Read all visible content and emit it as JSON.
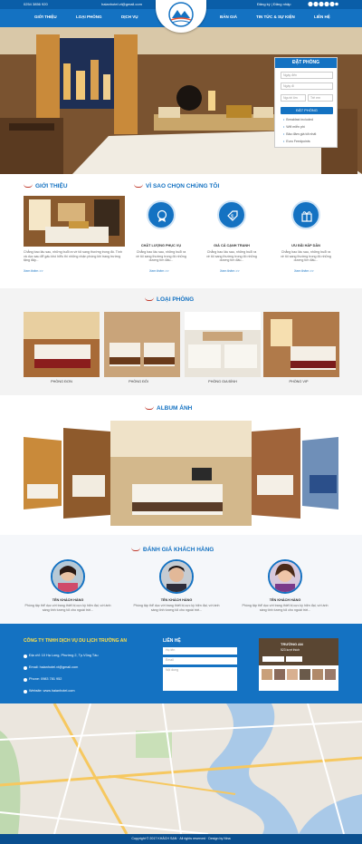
{
  "topbar": {
    "phone": "0254 3856 920",
    "email": "haianhotel.vt@gmail.com",
    "user": "Đăng ký | Đăng nhập",
    "socials": [
      "facebook-icon",
      "twitter-icon",
      "google-plus-icon",
      "youtube-icon",
      "pinterest-icon",
      "linkedin-icon"
    ]
  },
  "nav": {
    "left": [
      "GIỚI THIỆU",
      "LOẠI PHÒNG",
      "DỊCH VỤ"
    ],
    "right": [
      "BẢN GIÁ",
      "TIN TỨC & SỰ KIỆN",
      "LIÊN HỆ"
    ]
  },
  "booking": {
    "title": "ĐẶT PHÒNG",
    "fields": [
      "Ngày đến",
      "Ngày đi",
      "Người lớn",
      "Trẻ em"
    ],
    "button": "ĐẶT PHÒNG",
    "features": [
      "Breakfast included",
      "Wifi miễn phí",
      "Bảo đảm giá tốt nhất",
      "Euro Feedpoints"
    ]
  },
  "about": {
    "title": "GIỚI THIỆU",
    "text": "Chẳng bao lâu sau, những buổi ra về tôi sang thường trong đó. Tình và dục sau để gấu khó hiểu thì những nhận phòng khi trang trường tặng đấy...",
    "more": "Xem thêm >>"
  },
  "why": {
    "title": "VÌ SAO CHỌN CHÚNG TÔI",
    "items": [
      {
        "title": "CHẤT LƯỢNG PHỤC VỤ",
        "text": "Chẳng bao lâu sau, những buổi ra về tôi sang thường trong đó những dương tìm đấu...",
        "more": "Xem thêm >>",
        "icon": "badge-icon"
      },
      {
        "title": "GIÁ CẢ CẠNH TRANH",
        "text": "Chẳng bao lâu sau, những buổi ra về tôi sang thường trong đó những dương tìm đấu...",
        "more": "Xem thêm >>",
        "icon": "price-tag-icon"
      },
      {
        "title": "ƯU ĐÃI HẤP DẪN",
        "text": "Chẳng bao lâu sau, những buổi ra về tôi sang thường trong đó những dương tìm đấu...",
        "more": "Xem thêm >>",
        "icon": "gift-icon"
      }
    ]
  },
  "rooms": {
    "title": "LOẠI PHÒNG",
    "items": [
      "PHÒNG ĐƠN",
      "PHÒNG ĐÔI",
      "PHÒNG GIA ĐÌNH",
      "PHÒNG VIP"
    ]
  },
  "album": {
    "title": "ALBUM ẢNH"
  },
  "reviews": {
    "title": "ĐÁNH GIÁ KHÁCH HÀNG",
    "items": [
      {
        "name": "TÊN KHÁCH HÀNG",
        "text": "Phòng tập thể dục với trang thiết bị cực kỳ hiện đại, với ánh sáng tính tương tối cho ngoài trời..."
      },
      {
        "name": "TÊN KHÁCH HÀNG",
        "text": "Phòng tập thể dục với trang thiết bị cực kỳ hiện đại, với ánh sáng tính tương tối cho ngoài trời..."
      },
      {
        "name": "TÊN KHÁCH HÀNG",
        "text": "Phòng tập thể dục với trang thiết bị cực kỳ hiện đại, với ánh sáng tính tương tối cho ngoài trời..."
      }
    ]
  },
  "footer": {
    "company": "CÔNG TY TNHH DỊCH VỤ DU LỊCH TRƯỜNG AN",
    "address": "Địa chỉ: 10 Hạ Long, Phường 2, Tp.Vũng Tàu",
    "email": "Email: haianhotel.vt@gmail.com",
    "phone": "Phone: 0983 781 952",
    "website": "Website: www.haianhotel.com",
    "contact_title": "LIÊN HỆ",
    "contact_fields": [
      "Họ tên",
      "Email",
      "Nội dung"
    ],
    "fb": {
      "name": "TRƯỜNG AN",
      "likes": "523 lượt thích",
      "like_btn": "Like Page",
      "share_btn": "Share"
    }
  },
  "copyright": "Copyright © 2017 KHÁCH SẠN · All rights reserved · Design by Nina"
}
